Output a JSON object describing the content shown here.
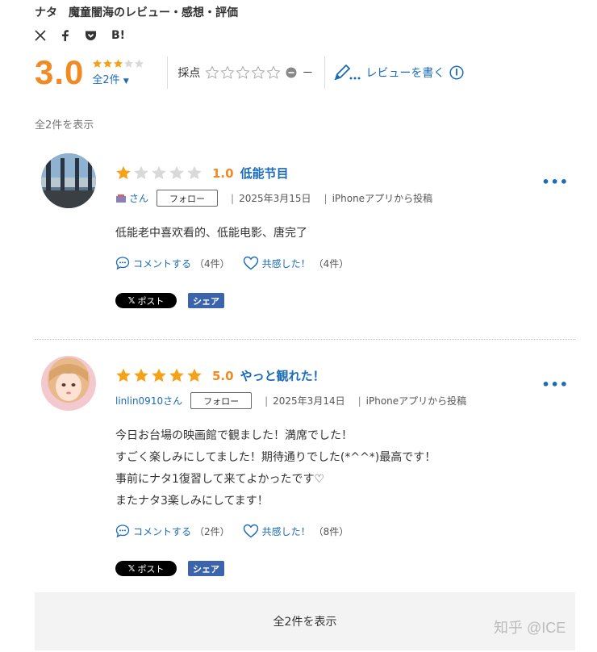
{
  "header": {
    "title": "ナタ　魔童闇海のレビュー・感想・評価",
    "share_icons": [
      "x-icon",
      "facebook-icon",
      "pocket-icon",
      "hatena-bookmark-icon"
    ],
    "hatena_label": "B!"
  },
  "summary": {
    "score": "3.0",
    "stars": 3,
    "count_label": "全2件",
    "saiten_label": "採点",
    "saiten_dash": "－",
    "write_review_label": "レビューを書く"
  },
  "show_all_top": "全2件を表示",
  "reviews": [
    {
      "stars": 1,
      "score": "1.0",
      "title": "低能节目",
      "user": "さん",
      "follow_label": "フォロー",
      "date": "2025年3月15日",
      "source": "iPhoneアプリから投稿",
      "text_lines": [
        "低能老中喜欢看的、低能电影、唐完了"
      ],
      "comment_label": "コメントする",
      "comment_count": "（4件）",
      "like_label": "共感した！",
      "like_count": "（4件）",
      "post_label": "ポスト",
      "share_label": "シェア"
    },
    {
      "stars": 5,
      "score": "5.0",
      "title": "やっと観れた！",
      "user": "linlin0910さん",
      "follow_label": "フォロー",
      "date": "2025年3月14日",
      "source": "iPhoneアプリから投稿",
      "text_lines": [
        "今日お台場の映画館で観ました！満席でした！",
        "すごく楽しみにしてました！期待通りでした(*^^*)最高です！",
        "事前にナタ1復習して来てよかったです♡",
        "またナタ3楽しみにしてます！"
      ],
      "comment_label": "コメントする",
      "comment_count": "（2件）",
      "like_label": "共感した！",
      "like_count": "（8件）",
      "post_label": "ポスト",
      "share_label": "シェア"
    }
  ],
  "show_all_bottom": "全2件を表示",
  "watermark": "知乎 @ICE",
  "colors": {
    "accent_orange": "#f08a24",
    "link_blue": "#1a6bb8",
    "share_blue": "#3b64ad",
    "star_orange": "#f5a21b",
    "star_gray": "#d9d9d9"
  }
}
